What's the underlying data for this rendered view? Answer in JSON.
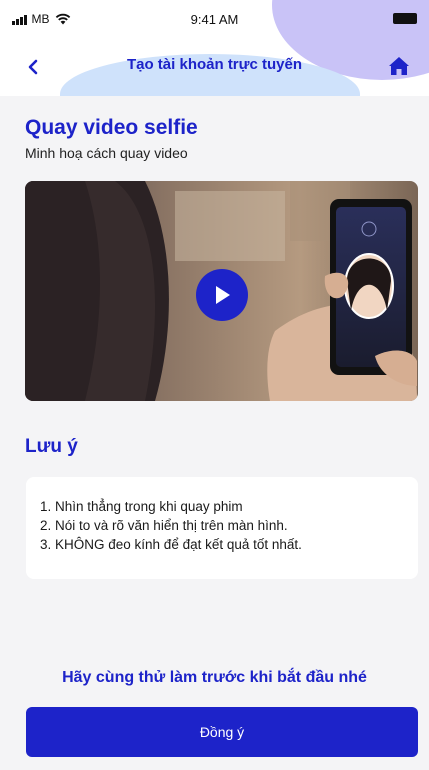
{
  "status_bar": {
    "carrier": "MB",
    "time": "9:41 AM",
    "icons": [
      "signal-icon",
      "wifi-icon",
      "battery-icon"
    ]
  },
  "nav": {
    "title": "Tạo tài khoản trực tuyến",
    "back_icon": "chevron-left-icon",
    "home_icon": "home-icon"
  },
  "section": {
    "title": "Quay video selfie",
    "subtitle": "Minh hoạ cách quay video"
  },
  "video": {
    "play_icon": "play-icon"
  },
  "note": {
    "title": "Lưu ý",
    "items": [
      "1. Nhìn thẳng trong khi quay phim",
      "2. Nói to và rõ văn hiển thị trên màn hình.",
      "3. KHÔNG đeo kính để đạt kết quả tốt nhất."
    ]
  },
  "hint": "Hãy cùng thử làm trước khi bắt đầu nhé",
  "button": {
    "agree_label": "Đồng ý"
  },
  "colors": {
    "primary": "#1d23c9",
    "background": "#f4f4f6",
    "card": "#ffffff",
    "accent_purple": "#c9c3f7",
    "accent_blue": "#cfe2fb"
  }
}
